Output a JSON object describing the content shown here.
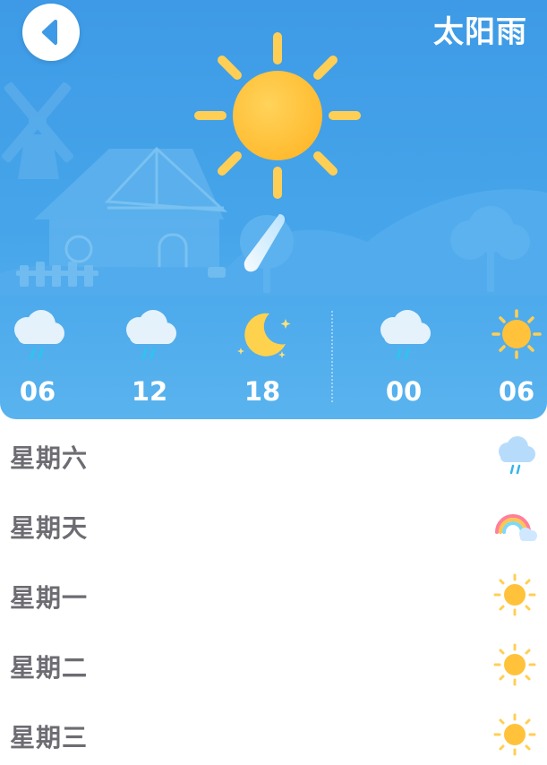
{
  "header": {
    "title": "太阳雨",
    "back_icon": "chevron-left-icon",
    "condition_icon": "sun-with-rain-icon"
  },
  "hourly": [
    {
      "time": "06",
      "icon": "cloud-rain-icon"
    },
    {
      "time": "12",
      "icon": "cloud-rain-icon"
    },
    {
      "time": "18",
      "icon": "moon-stars-icon"
    },
    {
      "time": "00",
      "icon": "cloud-rain-icon"
    },
    {
      "time": "06",
      "icon": "sun-icon"
    }
  ],
  "daily": [
    {
      "day": "星期六",
      "icon": "cloud-rain-icon"
    },
    {
      "day": "星期天",
      "icon": "rainbow-icon"
    },
    {
      "day": "星期一",
      "icon": "sun-icon"
    },
    {
      "day": "星期二",
      "icon": "sun-icon"
    },
    {
      "day": "星期三",
      "icon": "sun-icon"
    }
  ],
  "colors": {
    "sky_top": "#3e9ae6",
    "sky_bottom": "#59b3ee",
    "sun": "#ffc23a",
    "sun_ray": "#ffcf55",
    "day_text": "#6c6c72"
  }
}
